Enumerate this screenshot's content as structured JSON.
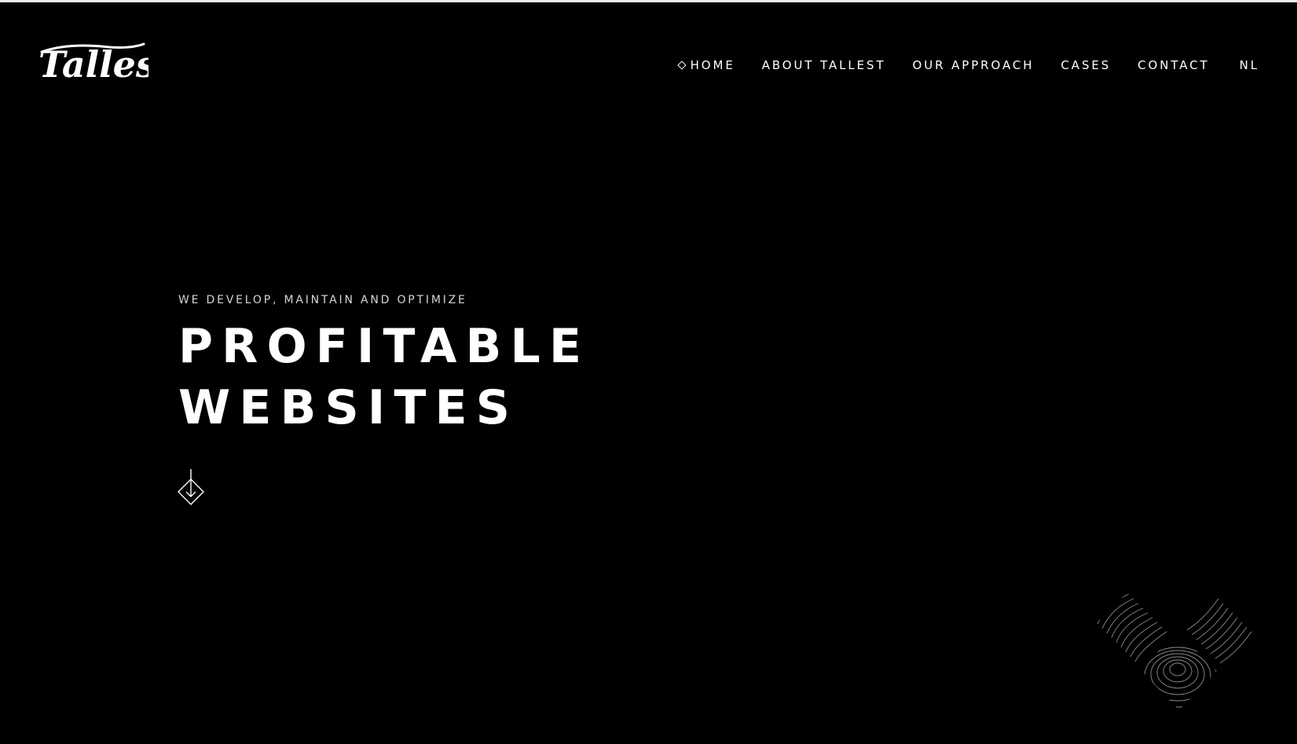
{
  "brand": {
    "name": "Tallest",
    "icon": "tallest-script-logo"
  },
  "nav": {
    "items": [
      {
        "label": "HOME",
        "active": true,
        "icon": "diamond-icon"
      },
      {
        "label": "ABOUT TALLEST"
      },
      {
        "label": "OUR APPROACH"
      },
      {
        "label": "CASES"
      },
      {
        "label": "CONTACT"
      },
      {
        "label": "NL"
      }
    ]
  },
  "hero": {
    "subtitle": "WE DEVELOP, MAINTAIN AND OPTIMIZE",
    "title_line1": "PROFITABLE",
    "title_line2": "WEBSITES",
    "scroll_icon": "arrow-down-diamond-icon"
  },
  "decor": {
    "icon": "contour-diamond-pattern"
  },
  "colors": {
    "background": "#000000",
    "text": "#ffffff",
    "subtitle": "#d6d6d6",
    "top_strip": "#f1f1f1"
  }
}
